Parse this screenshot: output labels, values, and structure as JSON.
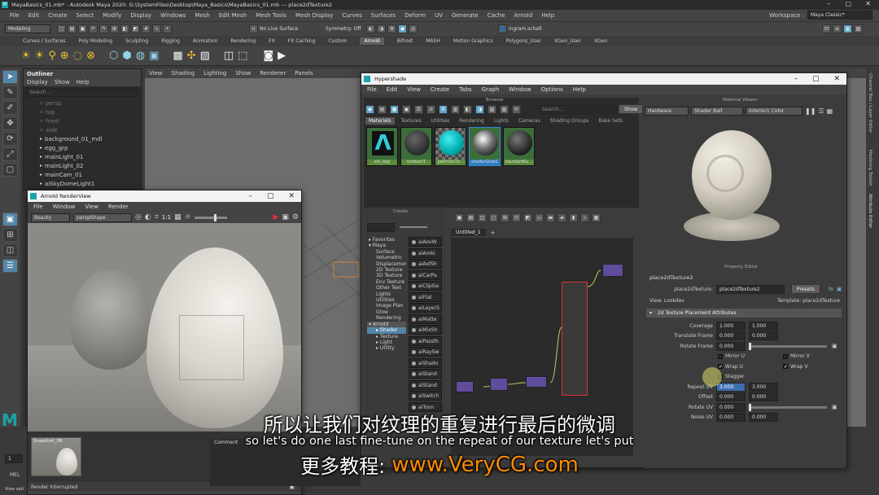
{
  "app": {
    "title": "MayaBasics_01.mb* - Autodesk Maya 2020: G:\\SystemFiles\\Desktop\\Maya_Basics\\MayaBasics_01.mb  ---  place2dTexture2",
    "menu": [
      "File",
      "Edit",
      "Create",
      "Select",
      "Modify",
      "Display",
      "Windows",
      "Mesh",
      "Edit Mesh",
      "Mesh Tools",
      "Mesh Display",
      "Curves",
      "Surfaces",
      "Deform",
      "UV",
      "Generate",
      "Cache",
      "Arnold",
      "Help"
    ],
    "workspace_label": "Workspace :",
    "workspace_value": "Maya Classic*"
  },
  "statusline": {
    "mode": "Modeling",
    "live": "No Live Surface",
    "symmetry": "Symmetry: Off",
    "user": "ingram.schell"
  },
  "shelf_tabs": [
    "Curves / Surfaces",
    "Poly Modeling",
    "Sculpting",
    "Rigging",
    "Animation",
    "Rendering",
    "FX",
    "FX Caching",
    "Custom",
    "Arnold",
    "Bifrost",
    "MASH",
    "Motion Graphics",
    "Polygons_User",
    "XGen_User",
    "XGen"
  ],
  "shelf_active": "Arnold",
  "outliner": {
    "title": "Outliner",
    "menu": [
      "Display",
      "Show",
      "Help"
    ],
    "search": "Search...",
    "items": [
      {
        "label": "persp",
        "dim": true
      },
      {
        "label": "top",
        "dim": true
      },
      {
        "label": "front",
        "dim": true
      },
      {
        "label": "side",
        "dim": true
      },
      {
        "label": "background_01_mdl",
        "dim": false
      },
      {
        "label": "egg_grp",
        "dim": false
      },
      {
        "label": "mainLight_01",
        "dim": false
      },
      {
        "label": "mainLight_02",
        "dim": false
      },
      {
        "label": "mainCam_01",
        "dim": false
      },
      {
        "label": "aiSkyDomeLight1",
        "dim": false
      }
    ]
  },
  "viewport": {
    "menu": [
      "View",
      "Shading",
      "Lighting",
      "Show",
      "Renderer",
      "Panels"
    ]
  },
  "right_tabs": [
    "Channel Box / Layer Editor",
    "Modeling Toolkit",
    "Attribute Editor"
  ],
  "arnold_view": {
    "title": "Arnold RenderView",
    "menu": [
      "File",
      "Window",
      "View",
      "Render"
    ],
    "aov": "Beauty",
    "camera": "perspShape",
    "ratio": "1:1",
    "snapshot": "Snapshot_08",
    "status": "Render Interrupted"
  },
  "hypershade": {
    "title": "Hypershade",
    "menu": [
      "File",
      "Edit",
      "View",
      "Create",
      "Tabs",
      "Graph",
      "Window",
      "Options",
      "Help"
    ],
    "browser_label": "Browser",
    "search": "Search...",
    "show": "Show",
    "tabs": [
      "Materials",
      "Textures",
      "Utilities",
      "Rendering",
      "Lights",
      "Cameras",
      "Shading Groups",
      "Bake Sets"
    ],
    "materials": [
      "aiS_egg",
      "lambert1",
      "particleClo...",
      "shaderGlow1",
      "standardSu..."
    ],
    "create_label": "Create",
    "create_tree": [
      "Favorites",
      "Maya",
      "Surface",
      "Volumetric",
      "Displacement",
      "2D Texture",
      "3D Texture",
      "Env Texture",
      "Other Text",
      "Lights",
      "Utilities",
      "Image Plan",
      "Glow",
      "Rendering",
      "Arnold",
      "Shader",
      "Texture",
      "Light",
      "Utility"
    ],
    "nodes": [
      "aiAovW",
      "aiAmbi",
      "aiAxfSh",
      "aiCarPa",
      "aiClipGe",
      "aiFlat",
      "aiLayerS",
      "aiMatte",
      "aiMixSh",
      "aiPassth",
      "aiRaySw",
      "aiShado",
      "aiStand",
      "aiStand",
      "aiSwitch",
      "aiToon"
    ],
    "graph_tab": "Untitled_1",
    "material_viewer": "Material Viewer",
    "mv_renderer": "Hardware",
    "mv_shape": "Shader Ball",
    "mv_env": "Interior1 Color"
  },
  "property_editor": {
    "title": "Property Editor",
    "node": "place2dTexture2",
    "node_label": "place2dTexture:",
    "node_value": "place2dTexture2",
    "presets": "Presets",
    "view": "View: Lookdev",
    "template": "Template: place2dTexture",
    "section": "2d Texture Placement Attributes",
    "rows": [
      {
        "label": "Coverage",
        "a": "1.000",
        "b": "1.000"
      },
      {
        "label": "Translate Frame",
        "a": "0.000",
        "b": "0.000"
      },
      {
        "label": "Rotate Frame",
        "a": "0.000",
        "b": ""
      }
    ],
    "checks": [
      {
        "left": "Mirror U",
        "left_on": false,
        "right": "Mirror V",
        "right_on": false
      },
      {
        "left": "Wrap U",
        "left_on": true,
        "right": "Wrap V",
        "right_on": true
      },
      {
        "left": "Stagger",
        "left_on": false,
        "right": "",
        "right_on": false
      }
    ],
    "rows2": [
      {
        "label": "Repeat UV",
        "a": "3.000",
        "b": "3.000"
      },
      {
        "label": "Offset",
        "a": "0.000",
        "b": "0.000"
      },
      {
        "label": "Rotate UV",
        "a": "0.000",
        "b": ""
      },
      {
        "label": "Noise UV",
        "a": "0.000",
        "b": "0.000"
      }
    ]
  },
  "bottom": {
    "comment": "Comment",
    "frame": "1",
    "mel": "MEL",
    "view_options": "View opti"
  },
  "subtitles": {
    "zh": "所以让我们对纹理的重复进行最后的微调",
    "en": "so let's do one last fine-tune on the repeat of our texture let's put",
    "promo_prefix": "更多教程:",
    "promo_url": "www.VeryCG.com"
  },
  "colors": {
    "maya_bg": "#444444",
    "accent": "#5285a6",
    "promo": "#ff8a00"
  }
}
